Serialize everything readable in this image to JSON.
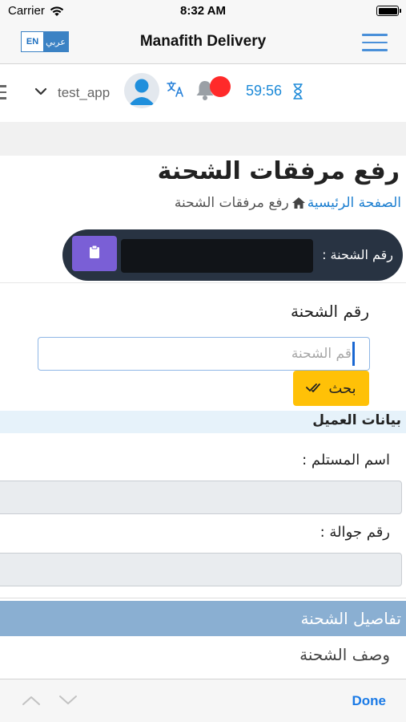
{
  "status_bar": {
    "carrier": "Carrier",
    "time": "8:32 AM"
  },
  "nav": {
    "lang_en": "EN",
    "lang_ar": "عربي",
    "title": "Manafith Delivery"
  },
  "header": {
    "username": "test_app",
    "session_timer": "59:56"
  },
  "page": {
    "title": "رفع مرفقات الشحنة",
    "breadcrumb_home": "الصفحة الرئيسية",
    "breadcrumb_current": "رفع مرفقات الشحنة"
  },
  "shipment_pill": {
    "label": "رقم الشحنة :"
  },
  "search": {
    "label": "رقم الشحنة",
    "placeholder": "قم الشحنة",
    "button_label": "بحث"
  },
  "customer": {
    "section_title": "بيانات العميل",
    "recipient_label": "اسم المستلم :",
    "mobile_label": "رقم جوالة :"
  },
  "shipment_details": {
    "section_title": "تفاصيل الشحنة",
    "description_label": "وصف الشحنة"
  },
  "keyboard_toolbar": {
    "done_label": "Done"
  },
  "colors": {
    "accent_blue": "#1d7fd0",
    "search_button": "#ffc107",
    "pill_background": "#283342",
    "clipboard_button": "#7a5fd6",
    "details_band": "#8aafd2",
    "notification_dot": "#ff2a2a"
  }
}
